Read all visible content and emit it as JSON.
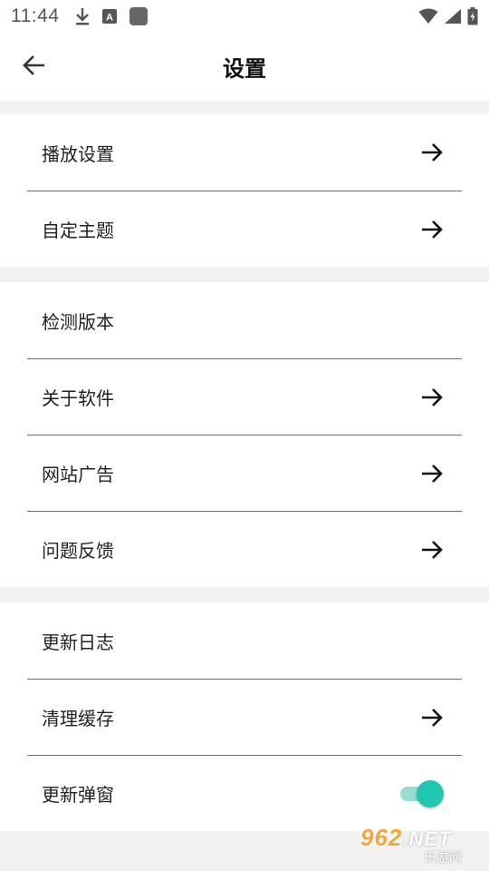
{
  "status_bar": {
    "time": "11:44",
    "icons": [
      "download-icon",
      "a-box-icon",
      "app-square-icon",
      "wifi-icon",
      "signal-icon",
      "battery-icon"
    ]
  },
  "header": {
    "title": "设置",
    "back_icon": "arrow-left-icon"
  },
  "groups": [
    {
      "items": [
        {
          "label": "播放设置",
          "trailing": "arrow"
        },
        {
          "label": "自定主题",
          "trailing": "arrow"
        }
      ]
    },
    {
      "items": [
        {
          "label": "检测版本",
          "trailing": "none"
        },
        {
          "label": "关于软件",
          "trailing": "arrow"
        },
        {
          "label": "网站广告",
          "trailing": "arrow"
        },
        {
          "label": "问题反馈",
          "trailing": "arrow"
        }
      ]
    },
    {
      "items": [
        {
          "label": "更新日志",
          "trailing": "none"
        },
        {
          "label": "清理缓存",
          "trailing": "arrow"
        },
        {
          "label": "更新弹窗",
          "trailing": "toggle",
          "toggle_on": true
        }
      ]
    }
  ],
  "colors": {
    "accent": "#22c7b2",
    "accent_track": "#97ddd3",
    "background": "#f1f1f1",
    "surface": "#ffffff"
  },
  "watermark": {
    "brand": "962",
    "domain": ".NET",
    "subtitle": "乐游网"
  }
}
